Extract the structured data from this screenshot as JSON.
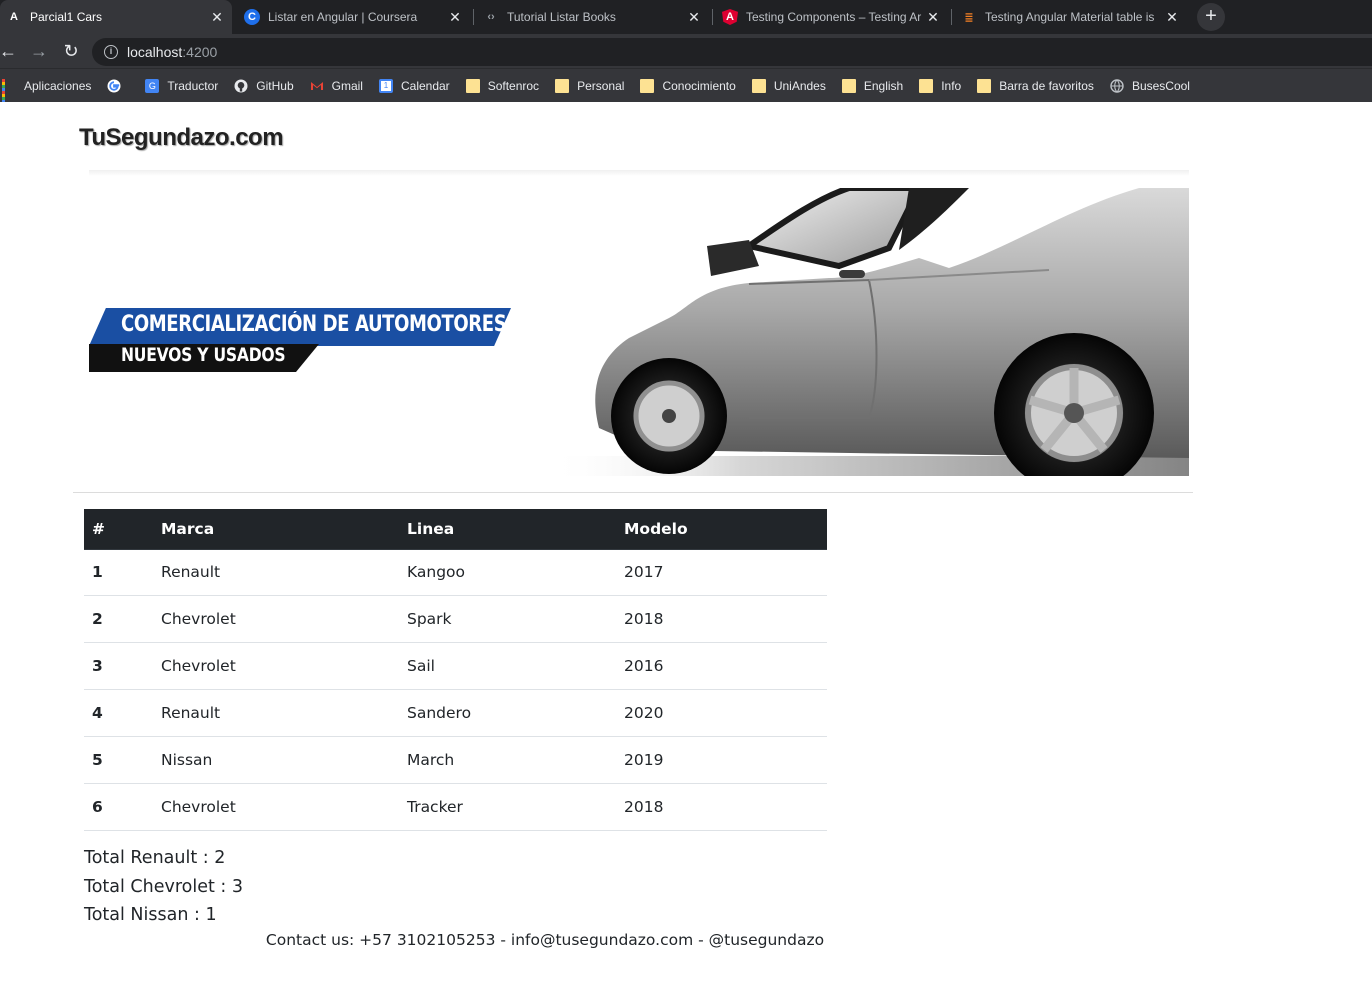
{
  "browser": {
    "tabs": [
      {
        "title": "Parcial1 Cars",
        "icon": "angular-a-icon",
        "active": true
      },
      {
        "title": "Listar en Angular | Coursera",
        "icon": "coursera-icon",
        "active": false
      },
      {
        "title": "Tutorial Listar Books",
        "icon": "code-brackets-icon",
        "active": false
      },
      {
        "title": "Testing Components – Testing Ar",
        "icon": "angular-red-icon",
        "active": false
      },
      {
        "title": "Testing Angular Material table is",
        "icon": "stackoverflow-icon",
        "active": false
      }
    ],
    "new_tab_label": "+",
    "close_glyph": "✕",
    "url_host": "localhost",
    "url_port": ":4200",
    "bookmarks": [
      {
        "label": "Aplicaciones",
        "icon": "apps-grid-icon"
      },
      {
        "label": "",
        "icon": "google-icon"
      },
      {
        "label": "Traductor",
        "icon": "translate-icon"
      },
      {
        "label": "GitHub",
        "icon": "github-icon"
      },
      {
        "label": "Gmail",
        "icon": "gmail-icon"
      },
      {
        "label": "Calendar",
        "icon": "calendar-icon"
      },
      {
        "label": "Softenroc",
        "icon": "folder-icon"
      },
      {
        "label": "Personal",
        "icon": "folder-icon"
      },
      {
        "label": "Conocimiento",
        "icon": "folder-icon"
      },
      {
        "label": "UniAndes",
        "icon": "folder-icon"
      },
      {
        "label": "English",
        "icon": "folder-icon"
      },
      {
        "label": "Info",
        "icon": "folder-icon"
      },
      {
        "label": "Barra de favoritos",
        "icon": "folder-icon"
      },
      {
        "label": "BusesCool",
        "icon": "globe-icon"
      }
    ]
  },
  "site": {
    "brand": "TuSegundazo.com",
    "banner_line1": "COMERCIALIZACIÓN DE AUTOMOTORES",
    "banner_line2": "NUEVOS Y USADOS"
  },
  "table": {
    "headers": [
      "#",
      "Marca",
      "Linea",
      "Modelo"
    ],
    "rows": [
      {
        "id": "1",
        "marca": "Renault",
        "linea": "Kangoo",
        "modelo": "2017"
      },
      {
        "id": "2",
        "marca": "Chevrolet",
        "linea": "Spark",
        "modelo": "2018"
      },
      {
        "id": "3",
        "marca": "Chevrolet",
        "linea": "Sail",
        "modelo": "2016"
      },
      {
        "id": "4",
        "marca": "Renault",
        "linea": "Sandero",
        "modelo": "2020"
      },
      {
        "id": "5",
        "marca": "Nissan",
        "linea": "March",
        "modelo": "2019"
      },
      {
        "id": "6",
        "marca": "Chevrolet",
        "linea": "Tracker",
        "modelo": "2018"
      }
    ]
  },
  "totals": [
    "Total Renault : 2",
    "Total Chevrolet : 3",
    "Total Nissan : 1"
  ],
  "footer": "Contact us: +57 3102105253 - info@tusegundazo.com - @tusegundazo",
  "colors": {
    "table_header_bg": "#212529",
    "banner_blue": "#1a4fa3",
    "tab_active_bg": "#35363a",
    "tabstrip_bg": "#202124"
  }
}
